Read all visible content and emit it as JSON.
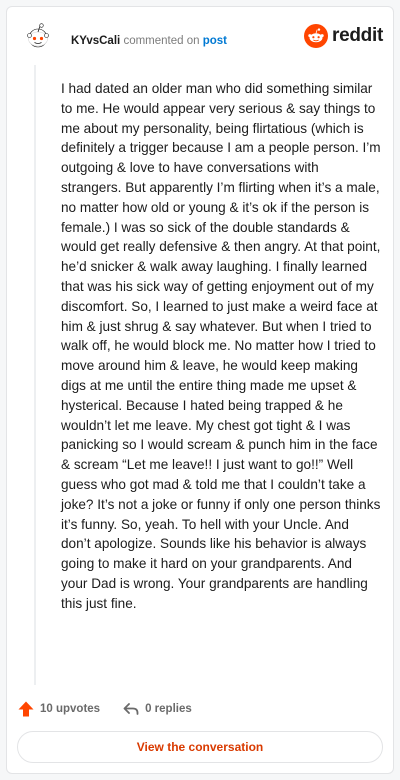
{
  "comment": {
    "username": "KYvsCali",
    "action_text": "commented on",
    "post_link": "post",
    "body": "I had dated an older man who did something similar to me. He would appear very serious & say things to me about my personality, being flirtatious (which is definitely a trigger because I am a people person. I’m outgoing & love to have conversations with strangers. But apparently I’m flirting when it’s a male, no matter how old or young & it’s ok if the person is female.) I was so sick of the double standards & would get really defensive & then angry. At that point, he’d snicker & walk away laughing. I finally learned that was his sick way of getting enjoyment out of my discomfort. So, I learned to just make a weird face at him & just shrug & say whatever. But when I tried to walk off, he would block me. No matter how I tried to move around him & leave, he would keep making digs at me until the entire thing made me upset & hysterical. Because I hated being trapped & he wouldn’t let me leave. My chest got tight & I was panicking so I would scream & punch him in the face & scream “Let me leave!! I just want to go!!” Well guess who got mad & told me that I couldn’t take a joke? It’s not a joke or funny if only one person thinks it’s funny. So, yeah. To hell with your Uncle. And don’t apologize. Sounds like his behavior is always going to make it hard on your grandparents. And your Dad is wrong. Your grandparents are handling this just fine."
  },
  "brand": {
    "name": "reddit",
    "icon": "reddit-snoo-icon",
    "color": "#ff4500"
  },
  "actions": {
    "upvotes_label": "10 upvotes",
    "replies_label": "0 replies"
  },
  "footer": {
    "button_label": "View the conversation"
  },
  "colors": {
    "accent": "#ff4500",
    "link": "#0079d3",
    "button_text": "#d93a00"
  }
}
